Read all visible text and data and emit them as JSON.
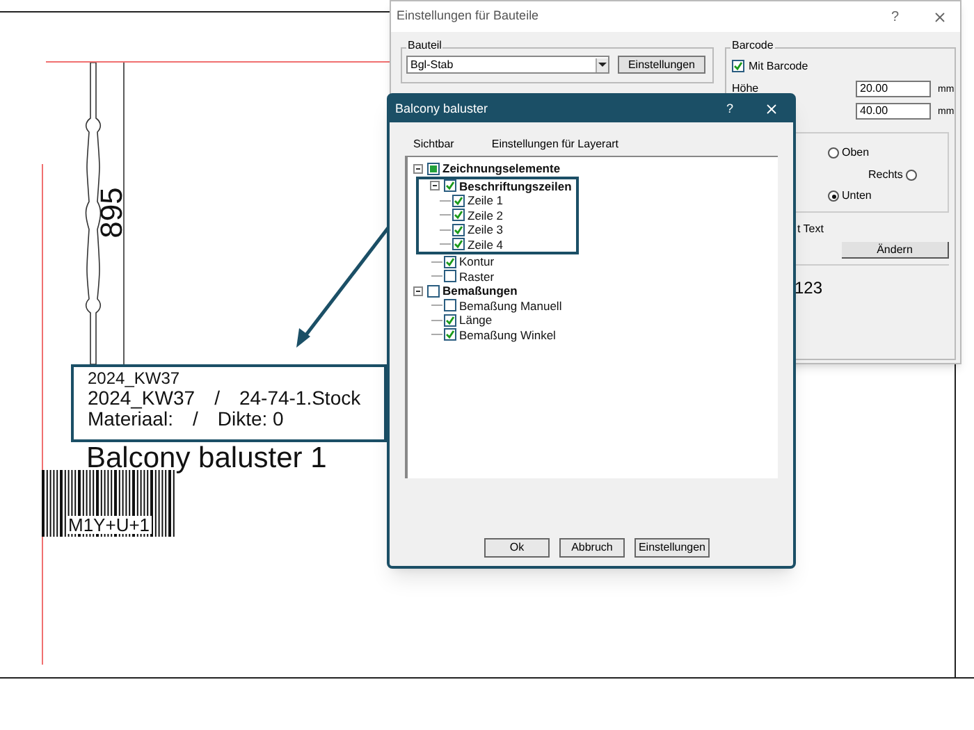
{
  "canvas": {
    "dimension": "895",
    "label_lines": [
      [
        "2024_KW37"
      ],
      [
        "2024_KW37",
        "/",
        "24-74-1.Stock"
      ],
      [
        "Materiaal:",
        "/",
        "Dikte: 0"
      ]
    ],
    "title": "Balcony baluster 1",
    "barcode_text": "M1Y+U+1"
  },
  "back_window": {
    "title": "Einstellungen für Bauteile",
    "help": "?",
    "bauteil": {
      "legend": "Bauteil",
      "value": "Bgl-Stab",
      "button": "Einstellungen"
    },
    "barcode": {
      "legend": "Barcode",
      "enabled": {
        "label": "Mit Barcode",
        "checked": true
      },
      "height_label": "Höhe",
      "fields": [
        {
          "value": "20.00",
          "unit": "mm"
        },
        {
          "value": "40.00",
          "unit": "mm"
        }
      ]
    },
    "position": [
      {
        "label": "Oben",
        "selected": false
      },
      {
        "label": "Rechts",
        "selected": false
      },
      {
        "label": "Unten",
        "selected": true
      }
    ],
    "text_label": "t Text",
    "change_button": "Ändern",
    "preview": "123"
  },
  "front_dialog": {
    "title": "Balcony baluster",
    "help": "?",
    "columns": [
      "Sichtbar",
      "Einstellungen für Layerart"
    ],
    "tree": [
      {
        "label": "Zeichnungselemente",
        "indeterminate": true,
        "expanded": true,
        "children": [
          {
            "label": "Beschriftungszeilen",
            "checked": true,
            "expanded": true,
            "highlighted": true,
            "children": [
              {
                "label": "Zeile 1",
                "checked": true
              },
              {
                "label": "Zeile 2",
                "checked": true
              },
              {
                "label": "Zeile 3",
                "checked": true
              },
              {
                "label": "Zeile 4",
                "checked": true
              }
            ]
          },
          {
            "label": "Kontur",
            "checked": true
          },
          {
            "label": "Raster",
            "checked": false
          }
        ]
      },
      {
        "label": "Bemaßungen",
        "checked": false,
        "expanded": true,
        "children": [
          {
            "label": "Bemaßung Manuell",
            "checked": false
          },
          {
            "label": "Länge",
            "checked": true
          },
          {
            "label": "Bemaßung Winkel",
            "checked": true
          }
        ]
      }
    ],
    "buttons": [
      "Ok",
      "Abbruch",
      "Einstellungen"
    ]
  }
}
